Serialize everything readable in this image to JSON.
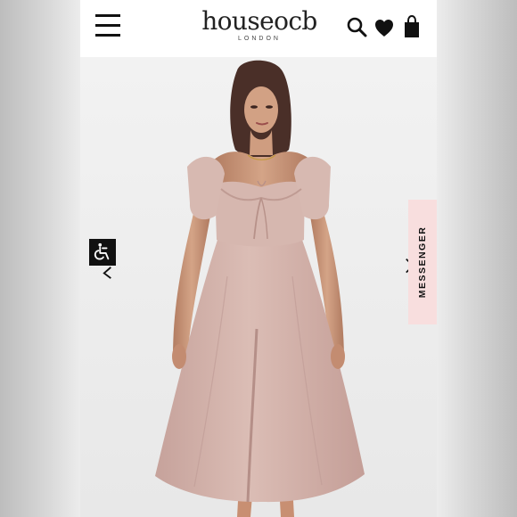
{
  "brand": {
    "name": "house of cb",
    "logo_main": "houseocb",
    "logo_sub": "LONDON"
  },
  "header": {
    "menu_icon": "hamburger-menu-icon",
    "search_icon": "search-icon",
    "wishlist_icon": "heart-icon",
    "bag_icon": "shopping-bag-icon"
  },
  "product": {
    "image": "model wearing pink puff-sleeve midi dress",
    "dress_color": "#d7b9b1"
  },
  "accessibility": {
    "icon": "wheelchair-accessibility-icon"
  },
  "carousel": {
    "prev_icon": "chevron-left-icon",
    "next_icon": "chevron-right-icon"
  },
  "messenger": {
    "label": "MESSENGER"
  },
  "colors": {
    "header_bg": "#ffffff",
    "accent_text": "#111111",
    "messenger_bg": "#f8dede",
    "accessibility_bg": "#111111"
  }
}
